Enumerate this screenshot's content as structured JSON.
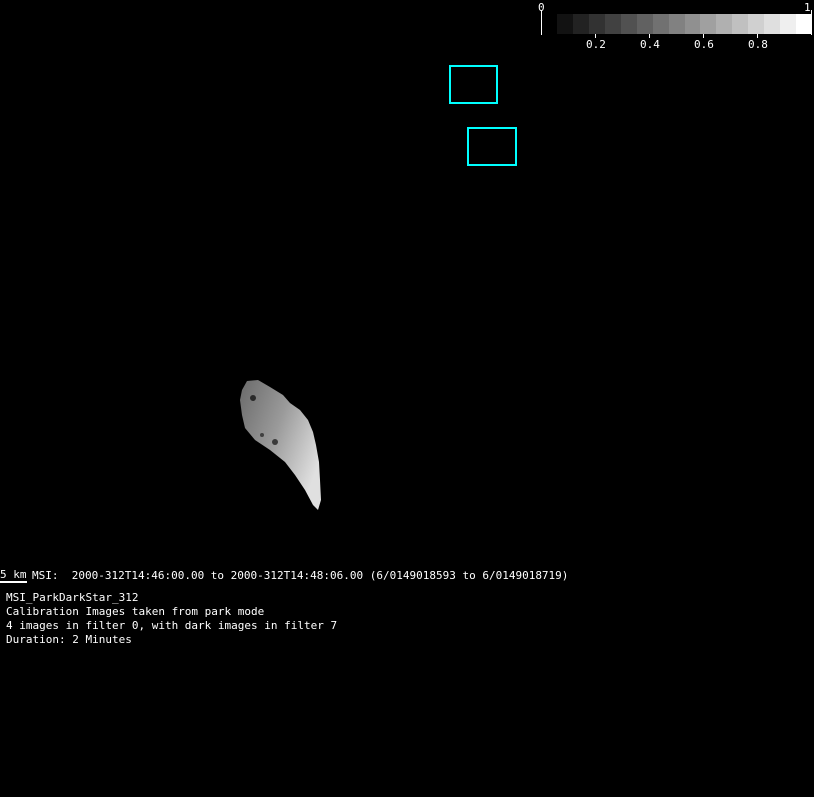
{
  "colorbar": {
    "min_label": "0",
    "max_label": "1",
    "tick_labels": [
      "0.2",
      "0.4",
      "0.6",
      "0.8"
    ],
    "steps": 16
  },
  "footprints": {
    "count": 2,
    "color": "#00ffff"
  },
  "scale_bar": {
    "label": "5 km"
  },
  "info": {
    "time_line": "MSI:  2000-312T14:46:00.00 to 2000-312T14:48:06.00 (6/0149018593 to 6/0149018719)",
    "title": "MSI_ParkDarkStar_312",
    "description": "Calibration Images taken from park mode",
    "filters": "4 images in filter 0, with dark images in filter 7",
    "duration": "Duration: 2 Minutes"
  }
}
